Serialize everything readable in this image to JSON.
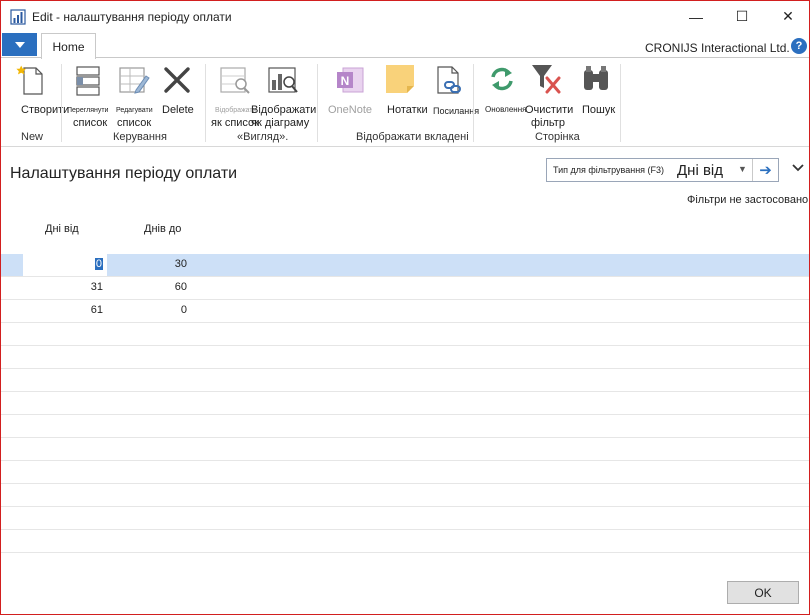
{
  "window": {
    "title": "Edit - налаштування періоду оплати",
    "min_glyph": "—",
    "max_glyph": "☐",
    "close_glyph": "✕"
  },
  "ribbon_tabs": {
    "home": "Home",
    "company": "CRONIJS Interactional Ltd.",
    "help_glyph": "?"
  },
  "ribbon": {
    "new_group": {
      "label": "New",
      "create": "Створити"
    },
    "manage_group": {
      "label": "Керування",
      "view_list_line1": "Переглянути",
      "view_list_line2": "список",
      "edit_list_line1": "Редагувати",
      "edit_list_line2": "список",
      "delete": "Delete"
    },
    "view_group": {
      "label": "«Вигляд».",
      "show_as_list_line1": "Відображати",
      "show_as_list_line2": "як список",
      "show_as_chart_line1": "Відображати",
      "show_as_chart_line2": "як діаграму"
    },
    "attach_group": {
      "label": "Відображати вкладені",
      "onenote": "OneNote",
      "notes": "Нотатки",
      "links": "Посилання"
    },
    "page_group": {
      "label": "Сторінка",
      "refresh": "Оновлення",
      "clear_filter_line1": "Очистити",
      "clear_filter_line2": "фільтр",
      "find": "Пошук"
    }
  },
  "page": {
    "title": "Налаштування періоду оплати",
    "filter_hint": "Тип для фільтрування (F3)",
    "filter_field": "Дні від",
    "filter_dropdown_glyph": "▼",
    "filter_go_glyph": "➔",
    "expand_glyph": "⌄",
    "filters_note": "Фільтри не застосовано"
  },
  "grid": {
    "columns": [
      "Дні від",
      "Днів до"
    ],
    "rows": [
      {
        "from": "0",
        "to": "30"
      },
      {
        "from": "31",
        "to": "60"
      },
      {
        "from": "61",
        "to": "0"
      }
    ]
  },
  "footer": {
    "ok": "OK"
  },
  "colors": {
    "accent": "#2b6fbf",
    "selection": "#cde0f7",
    "window_border": "#d21f1f"
  }
}
